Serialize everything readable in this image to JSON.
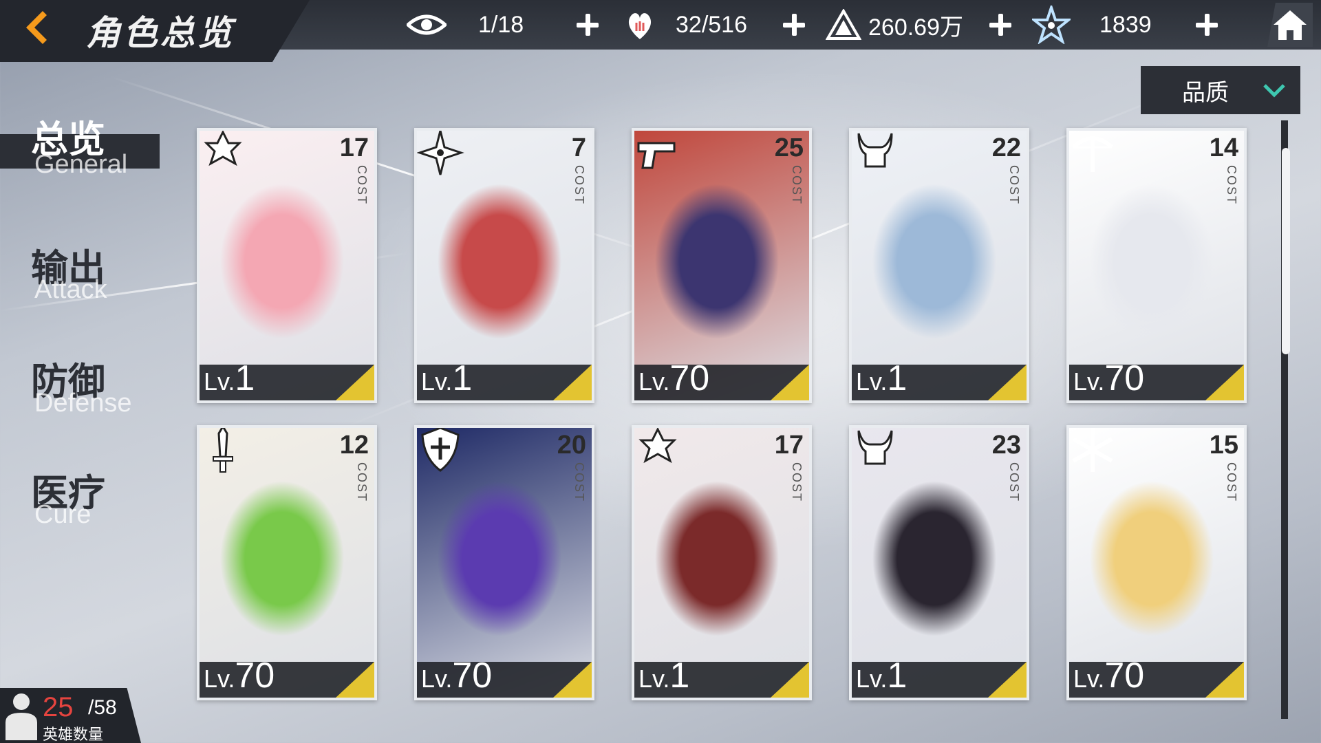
{
  "header": {
    "title": "角色总览",
    "resources": [
      {
        "icon": "eye-icon",
        "value": "1/18"
      },
      {
        "icon": "heart-hand-icon",
        "value": "32/516"
      },
      {
        "icon": "triangle-coin-icon",
        "value": "260.69万"
      },
      {
        "icon": "star-crystal-icon",
        "value": "1839"
      }
    ]
  },
  "sort": {
    "label": "品质"
  },
  "categories": [
    {
      "zh": "总览",
      "en": "General"
    },
    {
      "zh": "输出",
      "en": "Attack"
    },
    {
      "zh": "防御",
      "en": "Defense"
    },
    {
      "zh": "医疗",
      "en": "Cure"
    }
  ],
  "cost_label": "COST",
  "level_prefix": "Lv.",
  "cards": [
    {
      "cost": "17",
      "level": "1",
      "role_icon": "crest-icon",
      "colors": [
        "#f4a7b3",
        "#fbeff1"
      ]
    },
    {
      "cost": "7",
      "level": "1",
      "role_icon": "shuriken-icon",
      "colors": [
        "#c74a4a",
        "#eef0f4"
      ]
    },
    {
      "cost": "25",
      "level": "70",
      "role_icon": "pistol-icon",
      "colors": [
        "#3c3570",
        "#c0473c"
      ]
    },
    {
      "cost": "22",
      "level": "1",
      "role_icon": "horned-skull-icon",
      "colors": [
        "#9db9d8",
        "#eef1f6"
      ]
    },
    {
      "cost": "14",
      "level": "70",
      "role_icon": "crossbow-icon",
      "colors": [
        "#e6e8ee",
        "#ffffff"
      ]
    },
    {
      "cost": "12",
      "level": "70",
      "role_icon": "sword-icon",
      "colors": [
        "#79c94a",
        "#f3efe6"
      ]
    },
    {
      "cost": "20",
      "level": "70",
      "role_icon": "shield-icon",
      "colors": [
        "#5b3bb0",
        "#1f2a66"
      ]
    },
    {
      "cost": "17",
      "level": "1",
      "role_icon": "crest-icon",
      "colors": [
        "#7b2a2a",
        "#f1e9ea"
      ]
    },
    {
      "cost": "23",
      "level": "1",
      "role_icon": "horned-skull-icon",
      "colors": [
        "#2a2530",
        "#e9e7ee"
      ]
    },
    {
      "cost": "15",
      "level": "70",
      "role_icon": "snowflake-icon",
      "colors": [
        "#f0cf7c",
        "#ffffff"
      ]
    }
  ],
  "hero_count": {
    "current": "25",
    "max": "/58",
    "label": "英雄数量"
  },
  "colors": {
    "accent": "#e3c431",
    "panel": "#2c2f36",
    "back_arrow": "#f59a1c",
    "hero_count": "#e6443f"
  }
}
